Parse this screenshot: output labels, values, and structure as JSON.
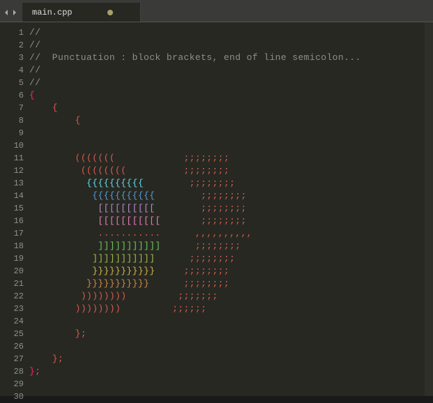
{
  "tab": {
    "filename": "main.cpp",
    "modified": true
  },
  "editor": {
    "line_numbers": [
      1,
      2,
      3,
      4,
      5,
      6,
      7,
      8,
      9,
      10,
      11,
      12,
      13,
      14,
      15,
      16,
      17,
      18,
      19,
      20,
      21,
      22,
      23,
      24,
      25,
      26,
      27,
      28,
      29,
      30
    ],
    "lines": [
      {
        "indent": "",
        "segments": [
          {
            "t": "//",
            "cls": "c-comment"
          }
        ]
      },
      {
        "indent": "",
        "segments": [
          {
            "t": "//",
            "cls": "c-comment"
          }
        ]
      },
      {
        "indent": "",
        "segments": [
          {
            "t": "//  Punctuation : block brackets, end of line semicolon...",
            "cls": "c-comment"
          }
        ]
      },
      {
        "indent": "",
        "segments": [
          {
            "t": "//",
            "cls": "c-comment"
          }
        ]
      },
      {
        "indent": "",
        "segments": [
          {
            "t": "//",
            "cls": "c-comment"
          }
        ]
      },
      {
        "indent": "",
        "segments": [
          {
            "t": "{",
            "cls": "c-magenta"
          }
        ]
      },
      {
        "indent": "    ",
        "segments": [
          {
            "t": "{",
            "cls": "c-red"
          }
        ]
      },
      {
        "indent": "        ",
        "segments": [
          {
            "t": "{",
            "cls": "c-red"
          }
        ]
      },
      {
        "indent": "",
        "segments": []
      },
      {
        "indent": "",
        "segments": []
      },
      {
        "indent": "        ",
        "segments": [
          {
            "t": "(((((((",
            "cls": "c-red"
          },
          {
            "t": "            ",
            "cls": ""
          },
          {
            "t": ";;;;;;;;",
            "cls": "c-red"
          }
        ]
      },
      {
        "indent": "         ",
        "segments": [
          {
            "t": "((((((((",
            "cls": "c-red"
          },
          {
            "t": "          ",
            "cls": ""
          },
          {
            "t": ";;;;;;;;",
            "cls": "c-red"
          }
        ]
      },
      {
        "indent": "          ",
        "segments": [
          {
            "t": "{{{{{{{{{{",
            "cls": "c-cyan"
          },
          {
            "t": "        ",
            "cls": ""
          },
          {
            "t": ";;;;;;;;",
            "cls": "c-red"
          }
        ]
      },
      {
        "indent": "           ",
        "segments": [
          {
            "t": "{{{{{{{{{{{",
            "cls": "c-blue"
          },
          {
            "t": "        ",
            "cls": ""
          },
          {
            "t": ";;;;;;;;",
            "cls": "c-red"
          }
        ]
      },
      {
        "indent": "            ",
        "segments": [
          {
            "t": "[[[[[[[[[[",
            "cls": "c-purple"
          },
          {
            "t": "        ",
            "cls": ""
          },
          {
            "t": ";;;;;;;;",
            "cls": "c-red"
          }
        ]
      },
      {
        "indent": "            ",
        "segments": [
          {
            "t": "[[[[[[[[[[[",
            "cls": "c-pink"
          },
          {
            "t": "       ",
            "cls": ""
          },
          {
            "t": ";;;;;;;;",
            "cls": "c-red"
          }
        ]
      },
      {
        "indent": "            ",
        "segments": [
          {
            "t": "...........",
            "cls": "c-red"
          },
          {
            "t": "      ",
            "cls": ""
          },
          {
            "t": ",,,,,,,,,,",
            "cls": "c-red"
          }
        ]
      },
      {
        "indent": "            ",
        "segments": [
          {
            "t": "]]]]]]]]]]]",
            "cls": "c-green"
          },
          {
            "t": "      ",
            "cls": ""
          },
          {
            "t": ";;;;;;;;",
            "cls": "c-red"
          }
        ]
      },
      {
        "indent": "           ",
        "segments": [
          {
            "t": "]]]]]]]]]]]",
            "cls": "c-olive"
          },
          {
            "t": "      ",
            "cls": ""
          },
          {
            "t": ";;;;;;;;",
            "cls": "c-red"
          }
        ]
      },
      {
        "indent": "           ",
        "segments": [
          {
            "t": "}}}}}}}}}}}",
            "cls": "c-yellow"
          },
          {
            "t": "     ",
            "cls": ""
          },
          {
            "t": ";;;;;;;;",
            "cls": "c-red"
          }
        ]
      },
      {
        "indent": "          ",
        "segments": [
          {
            "t": "}}}}}}}}}}}",
            "cls": "c-orange"
          },
          {
            "t": "      ",
            "cls": ""
          },
          {
            "t": ";;;;;;;;",
            "cls": "c-red"
          }
        ]
      },
      {
        "indent": "         ",
        "segments": [
          {
            "t": "))))))))",
            "cls": "c-red"
          },
          {
            "t": "         ",
            "cls": ""
          },
          {
            "t": ";;;;;;;",
            "cls": "c-red"
          }
        ]
      },
      {
        "indent": "        ",
        "segments": [
          {
            "t": "))))))))",
            "cls": "c-red"
          },
          {
            "t": "         ",
            "cls": ""
          },
          {
            "t": ";;;;;;",
            "cls": "c-red"
          }
        ]
      },
      {
        "indent": "",
        "segments": []
      },
      {
        "indent": "        ",
        "segments": [
          {
            "t": "};",
            "cls": "c-red"
          }
        ]
      },
      {
        "indent": "",
        "segments": []
      },
      {
        "indent": "    ",
        "segments": [
          {
            "t": "};",
            "cls": "c-red"
          }
        ]
      },
      {
        "indent": "",
        "segments": [
          {
            "t": "}",
            "cls": "c-magenta"
          },
          {
            "t": ";",
            "cls": "c-red"
          }
        ]
      },
      {
        "indent": "",
        "segments": []
      },
      {
        "indent": "",
        "segments": []
      }
    ]
  }
}
